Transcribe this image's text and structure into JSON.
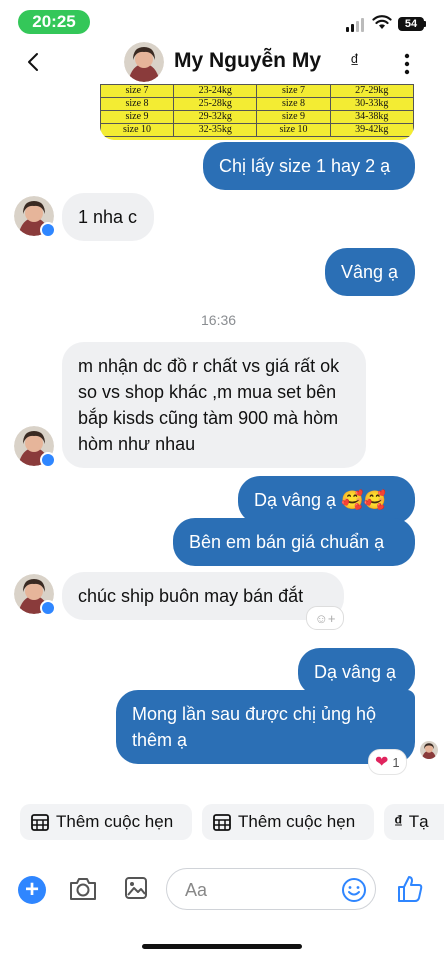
{
  "status_bar": {
    "time": "20:25",
    "battery": "54"
  },
  "header": {
    "contact_name": "My Nguyễn My",
    "currency_icon": "₫"
  },
  "size_table": {
    "rows": [
      [
        "size 7",
        "23-24kg",
        "size 7",
        "27-29kg"
      ],
      [
        "size 8",
        "25-28kg",
        "size 8",
        "30-33kg"
      ],
      [
        "size 9",
        "29-32kg",
        "size 9",
        "34-38kg"
      ],
      [
        "size 10",
        "32-35kg",
        "size 10",
        "39-42kg"
      ]
    ]
  },
  "messages": [
    {
      "direction": "out",
      "text": "Chị lấy size 1 hay 2 ạ"
    },
    {
      "direction": "in",
      "text": "1 nha c"
    },
    {
      "direction": "out",
      "text": "Vâng ạ"
    },
    {
      "direction": "timestamp",
      "text": "16:36"
    },
    {
      "direction": "in",
      "text": "m nhận dc đồ r chất vs giá rất ok so vs shop khác ,m mua set bên bắp kisds cũng tàm 900 mà hòm hòm như nhau"
    },
    {
      "direction": "out",
      "text": "Dạ vâng ạ 🥰🥰"
    },
    {
      "direction": "out",
      "text": "Bên em bán giá chuẩn ạ"
    },
    {
      "direction": "in",
      "text": "chúc ship buôn may bán đắt"
    },
    {
      "direction": "out",
      "text": "Dạ vâng ạ"
    },
    {
      "direction": "out",
      "text": "Mong lần sau được chị ủng hộ thêm ạ"
    }
  ],
  "reactions": {
    "add_reaction": "☺+",
    "heart_count": "1"
  },
  "quick_actions": [
    {
      "label": "Thêm cuộc hẹn",
      "icon": "calendar-icon"
    },
    {
      "label": "Thêm cuộc hẹn",
      "icon": "calendar-icon"
    },
    {
      "label": "Tạ",
      "icon": "currency-icon",
      "symbol": "₫"
    }
  ],
  "composer": {
    "placeholder": "Aa"
  },
  "colors": {
    "outgoing_bubble": "#2b6fb5",
    "incoming_bubble": "#eff0f2",
    "accent": "#2f86ff",
    "time_pill": "#34c759"
  }
}
